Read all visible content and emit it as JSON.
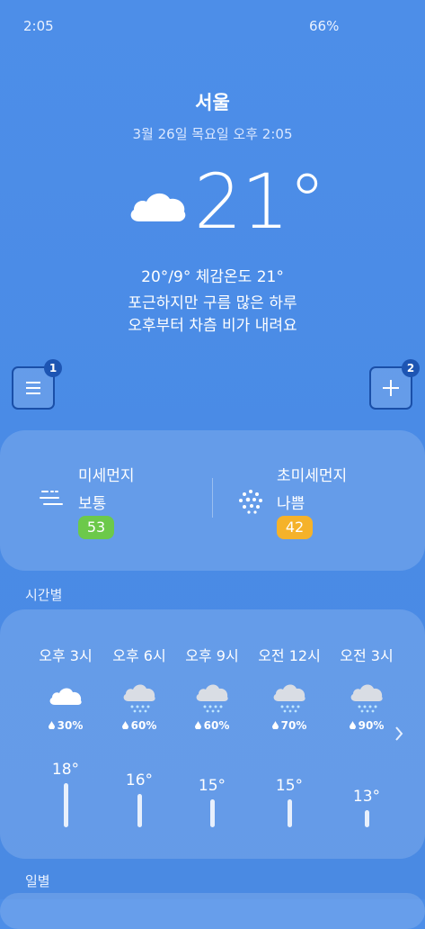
{
  "status_bar": {
    "time": "2:05",
    "battery": "66%"
  },
  "location": {
    "city": "서울",
    "datetime": "3월 26일 목요일 오후 2:05"
  },
  "current": {
    "icon": "cloud-icon",
    "temperature": "21°",
    "hi_lo_feels": "20°/9° 체감온도 21°",
    "description_line1": "포근하지만 구름 많은 하루",
    "description_line2": "오후부터 차츰 비가 내려요"
  },
  "buttons": {
    "menu_badge": "1",
    "add_badge": "2"
  },
  "air_quality": {
    "fine_dust": {
      "label": "미세먼지",
      "status": "보통",
      "value": "53",
      "color": "#6cc94a"
    },
    "ultrafine_dust": {
      "label": "초미세먼지",
      "status": "나쁨",
      "value": "42",
      "color": "#f5b22a"
    }
  },
  "hourly": {
    "title": "시간별",
    "items": [
      {
        "time": "오후 3시",
        "icon": "cloud-icon",
        "rain": "30%",
        "temp": "18°",
        "temp_value": 18
      },
      {
        "time": "오후 6시",
        "icon": "rain-cloud-icon",
        "rain": "60%",
        "temp": "16°",
        "temp_value": 16
      },
      {
        "time": "오후 9시",
        "icon": "rain-cloud-icon",
        "rain": "60%",
        "temp": "15°",
        "temp_value": 15
      },
      {
        "time": "오전 12시",
        "icon": "rain-cloud-icon",
        "rain": "70%",
        "temp": "15°",
        "temp_value": 15
      },
      {
        "time": "오전 3시",
        "icon": "rain-cloud-icon",
        "rain": "90%",
        "temp": "13°",
        "temp_value": 13
      }
    ]
  },
  "daily": {
    "title": "일별"
  },
  "colors": {
    "background": "#4a8ce6",
    "badge": "#1d55b3"
  }
}
